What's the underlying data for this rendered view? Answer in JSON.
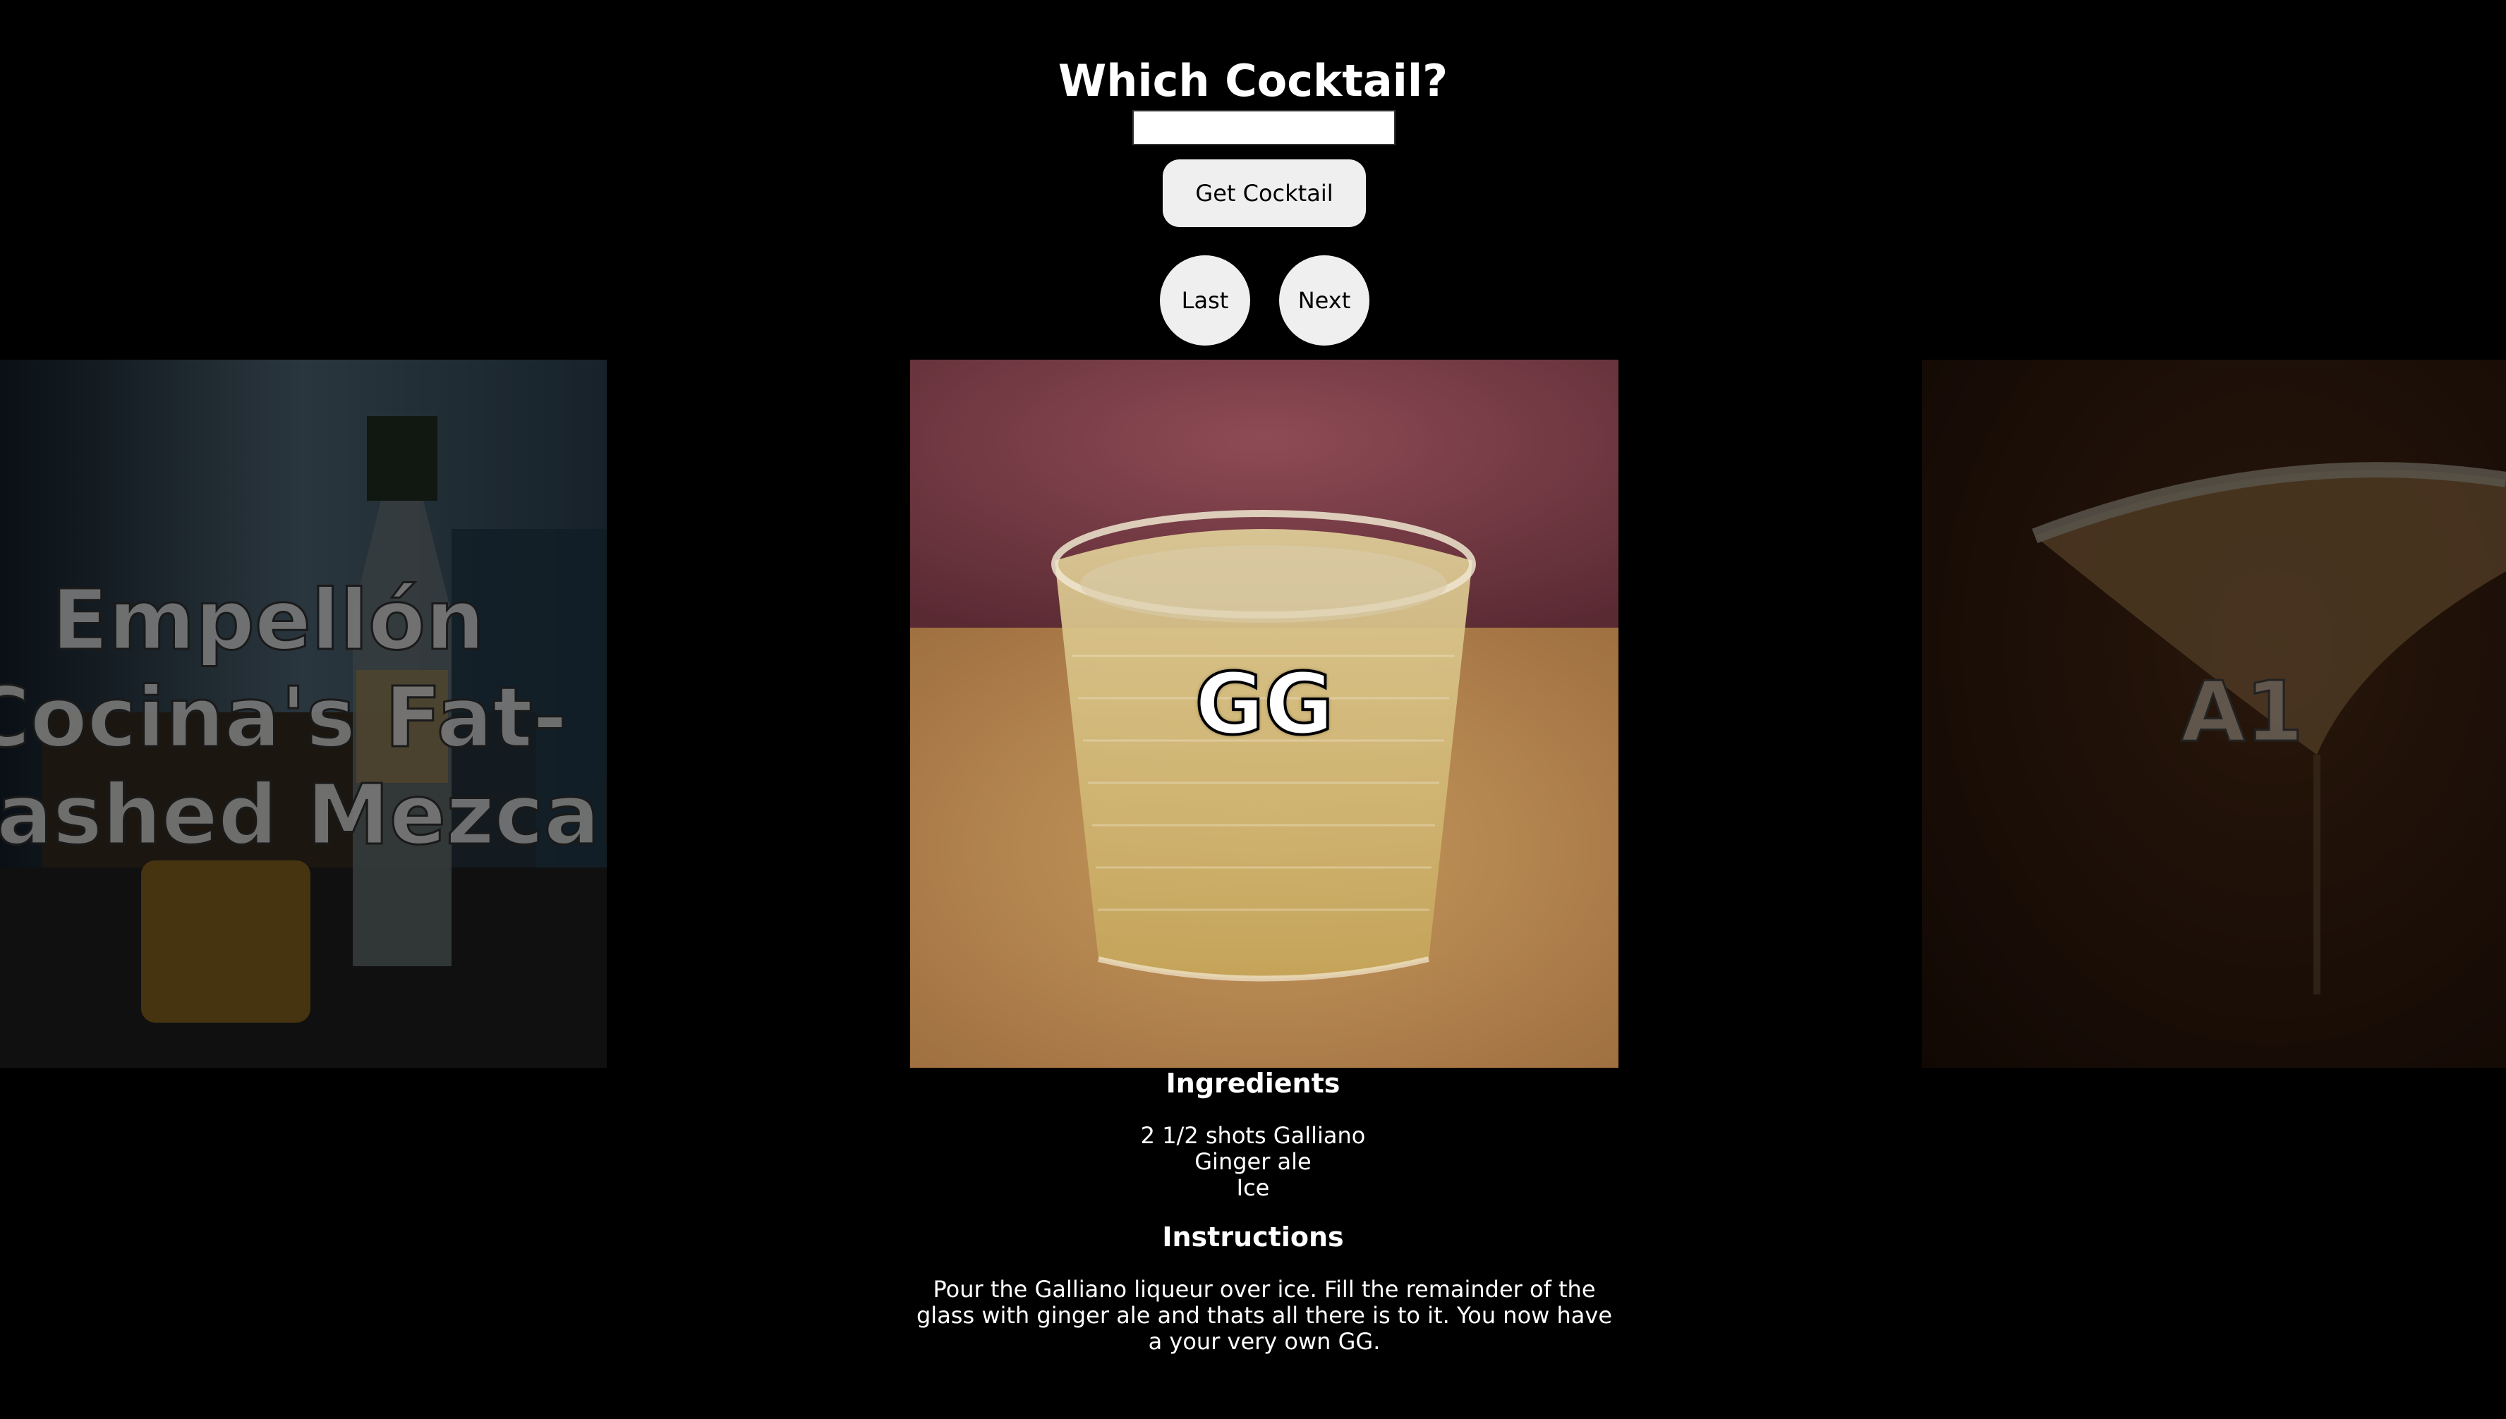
{
  "header": {
    "title": "Which Cocktail?"
  },
  "search": {
    "value": "",
    "placeholder": ""
  },
  "buttons": {
    "get_cocktail": "Get Cocktail",
    "last": "Last",
    "next": "Next"
  },
  "cards": {
    "previous": {
      "name": "Empellón Cocina's Fat-Washed Mezcal"
    },
    "current": {
      "name": "GG"
    },
    "next": {
      "name": "A1"
    }
  },
  "details": {
    "ingredients_heading": "Ingredients",
    "ingredients": [
      "2 1/2 shots Galliano",
      "Ginger ale",
      "Ice"
    ],
    "instructions_heading": "Instructions",
    "instructions": "Pour the Galliano liqueur over ice. Fill the remainder of the glass with ginger ale and thats all there is to it. You now have a your very own GG."
  }
}
